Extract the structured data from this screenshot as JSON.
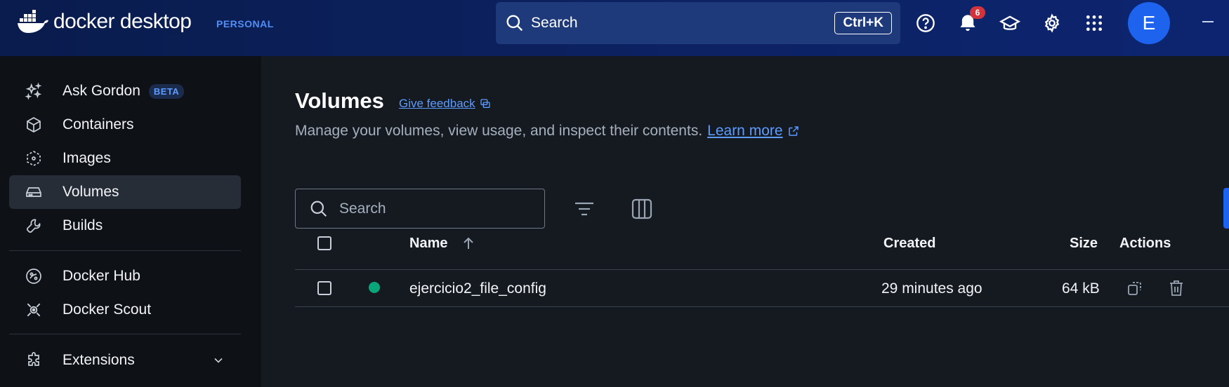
{
  "header": {
    "brand": "docker desktop",
    "plan": "PERSONAL",
    "search_label": "Search",
    "search_shortcut": "Ctrl+K",
    "notification_count": "6",
    "avatar_initial": "E",
    "icons": [
      "help-icon",
      "bell-icon",
      "learning-icon",
      "gear-icon",
      "apps-grid-icon"
    ]
  },
  "sidebar": {
    "items": [
      {
        "label": "Ask Gordon",
        "icon": "sparkles-icon",
        "badge": "BETA"
      },
      {
        "label": "Containers",
        "icon": "cube-icon"
      },
      {
        "label": "Images",
        "icon": "image-icon"
      },
      {
        "label": "Volumes",
        "icon": "drive-icon",
        "active": true
      },
      {
        "label": "Builds",
        "icon": "wrench-icon"
      },
      {
        "label": "Docker Hub",
        "icon": "hub-icon"
      },
      {
        "label": "Docker Scout",
        "icon": "scout-icon"
      },
      {
        "label": "Extensions",
        "icon": "puzzle-icon"
      }
    ]
  },
  "main": {
    "title": "Volumes",
    "feedback_label": "Give feedback",
    "subtitle": "Manage your volumes, view usage, and inspect their contents.",
    "learn_more": "Learn more",
    "search_placeholder": "Search",
    "table": {
      "columns": [
        "Name",
        "Created",
        "Size",
        "Actions"
      ],
      "sort_column": "Name",
      "sort_direction": "ascending",
      "rows": [
        {
          "name": "ejercicio2_file_config",
          "created": "29 minutes ago",
          "size": "64 kB",
          "status_color": "#0aa57a"
        }
      ]
    }
  },
  "colors": {
    "accent": "#1d63ed",
    "link": "#5c9bff",
    "in_use": "#0aa57a",
    "badge": "#d0343c"
  }
}
